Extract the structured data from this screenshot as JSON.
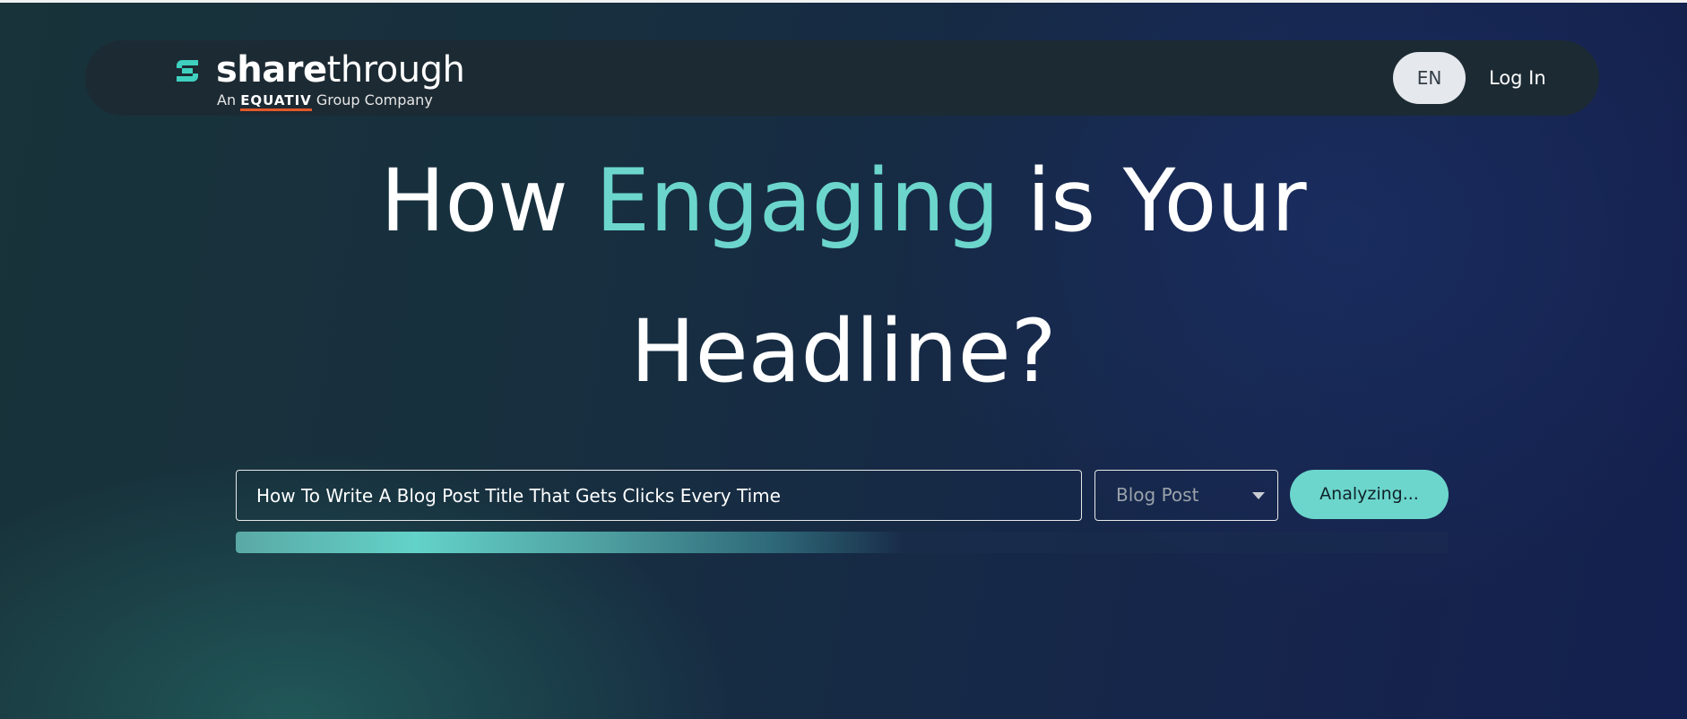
{
  "header": {
    "logo": {
      "wordmark_bold": "share",
      "wordmark_light": "through",
      "tagline_prefix": "An",
      "tagline_brand": "EQUATIV",
      "tagline_suffix": "Group Company",
      "mark_icon": "sharethrough-logo-icon"
    },
    "language_button": "EN",
    "login_link": "Log In"
  },
  "hero": {
    "title_part1": "How",
    "title_accent": "Engaging",
    "title_part2": "is Your",
    "title_line2": "Headline?"
  },
  "form": {
    "headline_input_value": "How To Write A Blog Post Title That Gets Clicks Every Time",
    "content_type_selected": "Blog Post",
    "select_icon": "caret-down-icon",
    "analyze_button": "Analyzing..."
  },
  "progress": {
    "fraction": 0.55
  },
  "colors": {
    "accent": "#6cd6cc",
    "navbar_bg": "#1c2a33",
    "equativ_underline": "#e2572a",
    "lang_button_bg": "#e5e8ec"
  }
}
